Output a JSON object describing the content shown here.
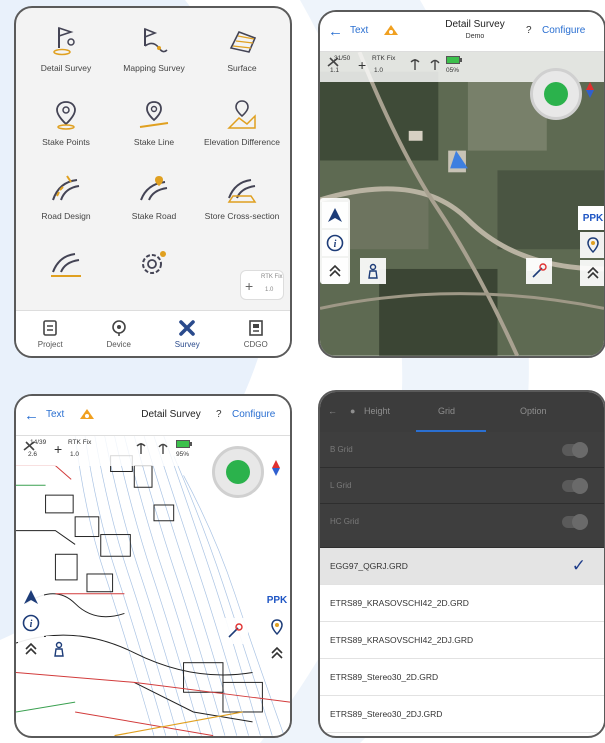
{
  "colors": {
    "accent": "#2a6fd1",
    "fix_green": "#2bb24c",
    "ppk_blue": "#1f56c4",
    "swoosh": "#e9f1fb"
  },
  "panel_home": {
    "apps": [
      {
        "label": "Detail Survey",
        "icon": "flag-point-icon"
      },
      {
        "label": "Mapping Survey",
        "icon": "mapping-icon"
      },
      {
        "label": "Surface",
        "icon": "surface-icon"
      },
      {
        "label": "Stake Points",
        "icon": "stake-point-icon"
      },
      {
        "label": "Stake Line",
        "icon": "stake-line-icon"
      },
      {
        "label": "Elevation Difference",
        "icon": "elevation-icon"
      },
      {
        "label": "Road Design",
        "icon": "road-design-icon"
      },
      {
        "label": "Stake Road",
        "icon": "stake-road-icon"
      },
      {
        "label": "Store Cross-section",
        "icon": "cross-section-icon"
      },
      {
        "label": "",
        "icon": "road-tool-icon"
      },
      {
        "label": "",
        "icon": "gear-icon"
      }
    ],
    "rtk_mini": {
      "line1": "RTK Fix",
      "line2": "1.0"
    },
    "nav": [
      {
        "label": "Project",
        "icon": "project-icon"
      },
      {
        "label": "Device",
        "icon": "device-icon"
      },
      {
        "label": "Survey",
        "icon": "survey-icon"
      },
      {
        "label": "CDGO",
        "icon": "cdgo-icon"
      }
    ]
  },
  "panel_map_satellite": {
    "back": "←",
    "text_btn": "Text",
    "title": "Detail Survey",
    "subtitle": "Demo",
    "help": "?",
    "configure": "Configure",
    "sat_count": "31/50",
    "sat_sub": "1.1",
    "solution": "RTK Fix",
    "solution_sub": "1.0",
    "battery": "05%",
    "ppk": "PPK"
  },
  "panel_map_vector": {
    "back": "←",
    "text_btn": "Text",
    "title": "Detail Survey",
    "help": "?",
    "configure": "Configure",
    "sat_count": "14/39",
    "sat_sub": "2.6",
    "solution": "RTK Fix",
    "solution_sub": "1.0",
    "battery": "95%",
    "ppk": "PPK"
  },
  "panel_grid_list": {
    "tabs": [
      "Height",
      "Grid",
      "Option"
    ],
    "toggles": [
      "B Grid",
      "L Grid",
      "HC Grid"
    ],
    "files": [
      "EGG97_QGRJ.GRD",
      "ETRS89_KRASOVSCHI42_2D.GRD",
      "ETRS89_KRASOVSCHI42_2DJ.GRD",
      "ETRS89_Stereo30_2D.GRD",
      "ETRS89_Stereo30_2DJ.GRD"
    ],
    "check": "✓"
  }
}
